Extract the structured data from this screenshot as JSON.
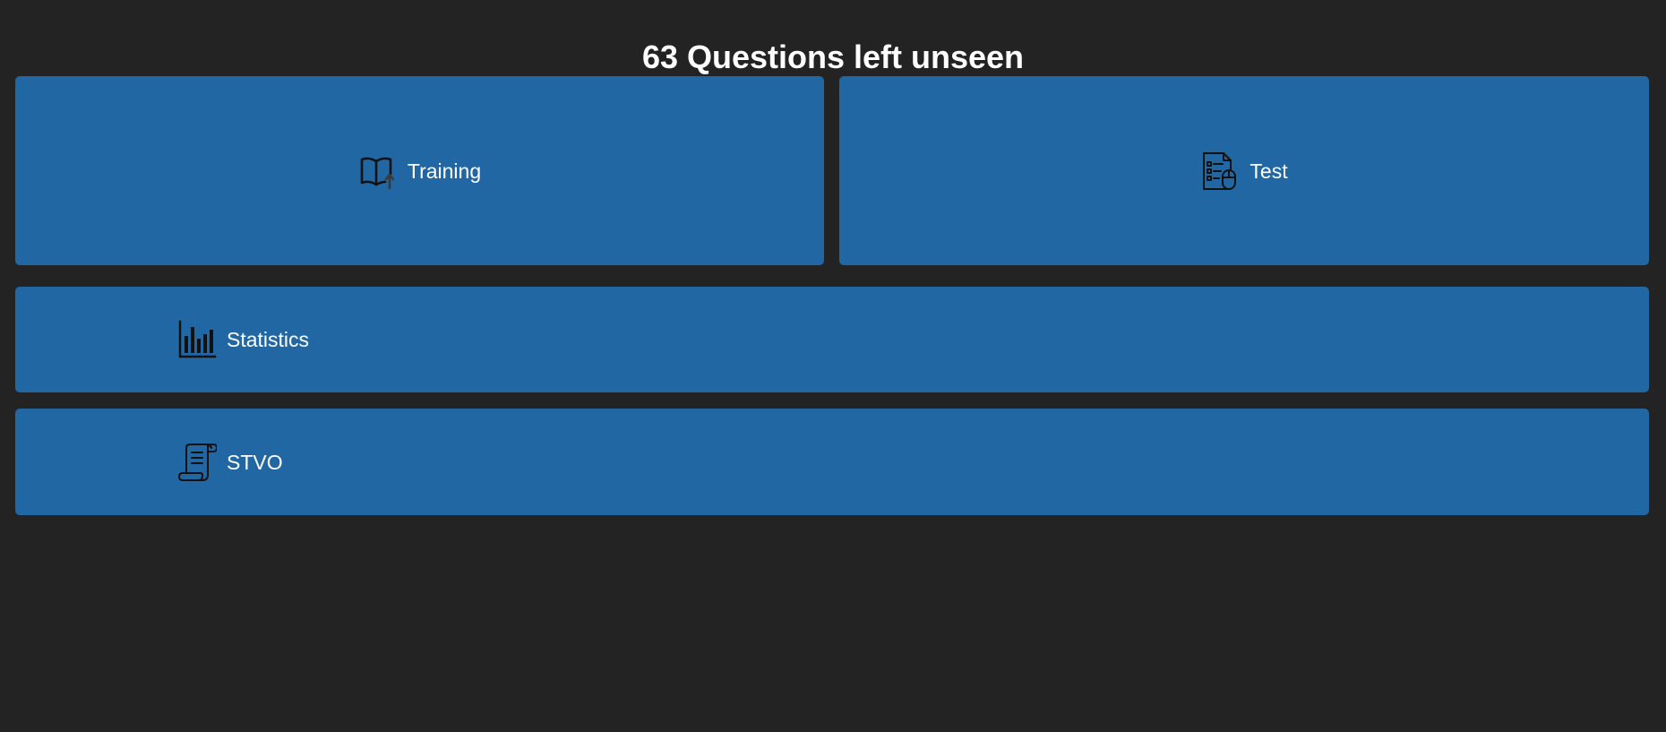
{
  "header": {
    "title": "63 Questions left unseen"
  },
  "menu": {
    "training": {
      "label": "Training",
      "icon": "book-upload-icon"
    },
    "test": {
      "label": "Test",
      "icon": "test-form-icon"
    },
    "statistics": {
      "label": "Statistics",
      "icon": "bar-chart-icon"
    },
    "stvo": {
      "label": "STVO",
      "icon": "scroll-document-icon"
    }
  },
  "colors": {
    "background": "#232323",
    "tile": "#2167a4",
    "text": "#ffffff",
    "icon": "#111111"
  }
}
